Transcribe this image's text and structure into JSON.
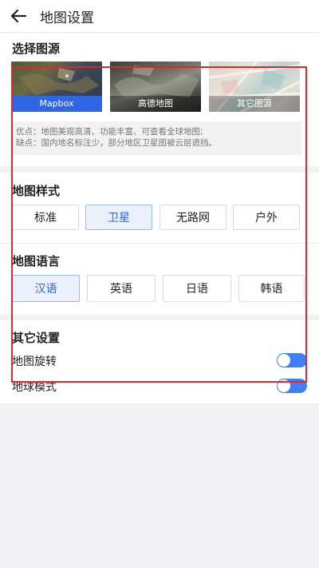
{
  "header": {
    "title": "地图设置",
    "back_icon": "arrow-left-icon"
  },
  "source_section": {
    "title": "选择图源",
    "tiles": [
      {
        "label": "Mapbox",
        "selected": true
      },
      {
        "label": "高德地图",
        "selected": false
      },
      {
        "label": "其它图源",
        "selected": false
      }
    ],
    "info_line1": "优点：地图美观高清、功能丰富、可查看全球地图;",
    "info_line2": "缺点：国内地名标注少，部分地区卫星图被云层遮挡。"
  },
  "style_section": {
    "title": "地图样式",
    "options": [
      "标准",
      "卫星",
      "无路网",
      "户外"
    ],
    "selected": "卫星"
  },
  "language_section": {
    "title": "地图语言",
    "options": [
      "汉语",
      "英语",
      "日语",
      "韩语"
    ],
    "selected": "汉语"
  },
  "other_section": {
    "title": "其它设置",
    "rotate_label": "地图旋转",
    "rotate_on": true,
    "globe_label": "地球模式",
    "globe_on": true
  },
  "colors": {
    "accent": "#2f66e6",
    "toggle": "#3f7ef3",
    "highlight_box": "#e1252e"
  }
}
